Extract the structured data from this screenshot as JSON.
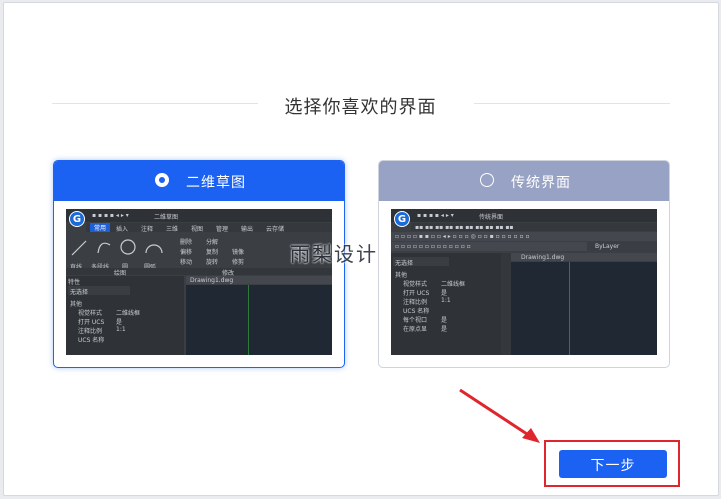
{
  "title": "选择你喜欢的界面",
  "options": [
    {
      "label": "二维草图",
      "selected": true
    },
    {
      "label": "传统界面",
      "selected": false
    }
  ],
  "preview_left": {
    "doc_title": "二维草图",
    "tabs": [
      "常用",
      "插入",
      "注释",
      "三维",
      "视图",
      "管理",
      "输出",
      "云存储"
    ],
    "tools": [
      "直线",
      "多段线",
      "圆",
      "圆弧"
    ],
    "modify_tools": [
      "删除",
      "分解",
      "偏移",
      "复制",
      "镜像",
      "移动",
      "旋转",
      "修剪"
    ],
    "groups": [
      "绘图",
      "修改"
    ],
    "panel_title": "特性",
    "select_value": "无选择",
    "section": "其他",
    "props": [
      [
        "视觉样式",
        "二维线框"
      ],
      [
        "打开 UCS",
        "是"
      ],
      [
        "注释比例",
        "1:1"
      ],
      [
        "UCS 名称",
        ""
      ]
    ],
    "drawing_tab": "Drawing1.dwg"
  },
  "preview_right": {
    "doc_title": "传统界面",
    "layer": "ByLayer",
    "select_value": "无选择",
    "section": "其他",
    "props": [
      [
        "视觉样式",
        "二维线框"
      ],
      [
        "打开 UCS",
        "是"
      ],
      [
        "注释比例",
        "1:1"
      ],
      [
        "UCS 名称",
        ""
      ],
      [
        "每个视口",
        "是"
      ],
      [
        "在原点显",
        "是"
      ]
    ],
    "drawing_tab": "Drawing1.dwg"
  },
  "watermark": "雨梨设计",
  "next_button": "下一步",
  "colors": {
    "accent": "#1c62f2",
    "unselected": "#98a2c4",
    "highlight": "#e0262d"
  }
}
